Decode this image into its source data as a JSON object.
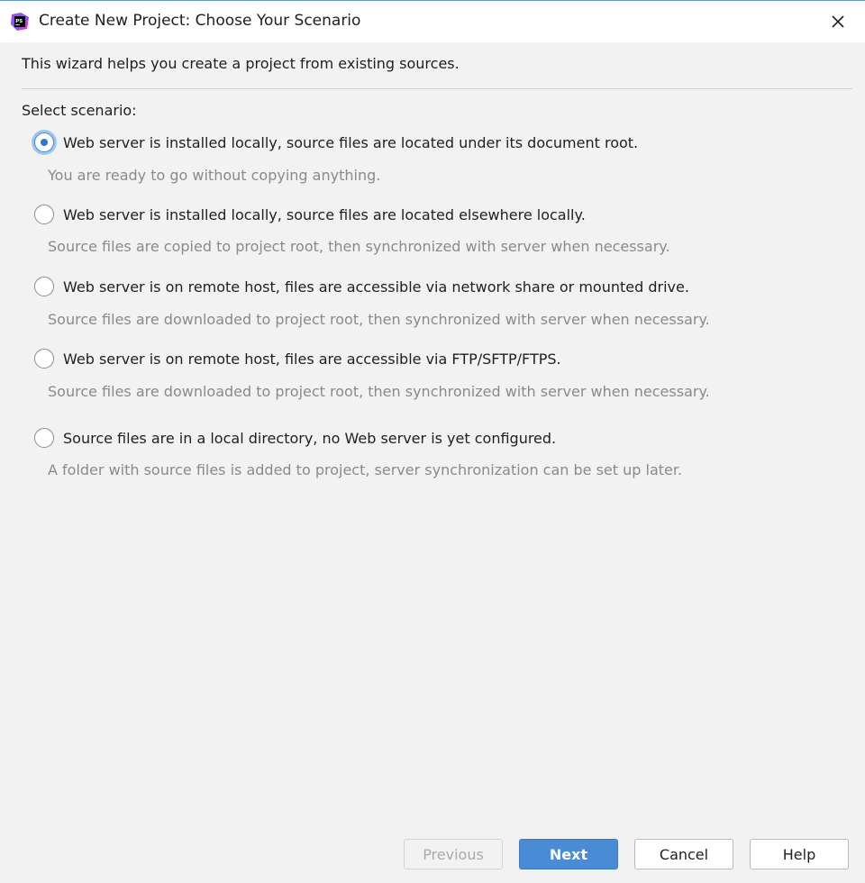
{
  "window": {
    "title": "Create New Project: Choose Your Scenario",
    "app_icon": "phpstorm-logo",
    "app_icon_text": "PS"
  },
  "intro_text": "This wizard helps you create a project from existing sources.",
  "select_label": "Select scenario:",
  "options": [
    {
      "label": "Web server is installed locally, source files are located under its document root.",
      "description": "You are ready to go without copying anything.",
      "checked": true
    },
    {
      "label": "Web server is installed locally, source files are located elsewhere locally.",
      "description": "Source files are copied to project root, then synchronized with server when necessary.",
      "checked": false
    },
    {
      "label": "Web server is on remote host, files are accessible via network share or mounted drive.",
      "description": "Source files are downloaded to project root, then synchronized with server when necessary.",
      "checked": false
    },
    {
      "label": "Web server is on remote host, files are accessible via FTP/SFTP/FTPS.",
      "description": "Source files are downloaded to project root, then synchronized with server when necessary.",
      "checked": false
    },
    {
      "label": "Source files are in a local directory, no Web server is yet configured.",
      "description": "A folder with source files is added to project, server synchronization can be set up later.",
      "checked": false
    }
  ],
  "buttons": {
    "previous": "Previous",
    "next": "Next",
    "cancel": "Cancel",
    "help": "Help"
  },
  "colors": {
    "accent": "#4a8bd6",
    "radio_selected": "#2e77cf",
    "description_text": "#8a8a8a",
    "background": "#f2f2f2"
  }
}
